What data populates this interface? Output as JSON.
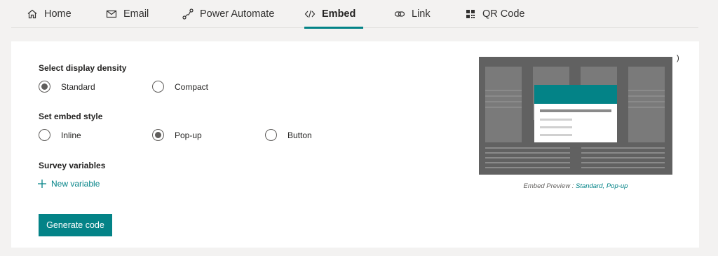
{
  "tabs": [
    {
      "label": "Home",
      "icon": "home-icon",
      "active": false
    },
    {
      "label": "Email",
      "icon": "email-icon",
      "active": false
    },
    {
      "label": "Power Automate",
      "icon": "flow-icon",
      "active": false
    },
    {
      "label": "Embed",
      "icon": "embed-icon",
      "active": true
    },
    {
      "label": "Link",
      "icon": "link-icon",
      "active": false
    },
    {
      "label": "QR Code",
      "icon": "qr-code-icon",
      "active": false
    }
  ],
  "density": {
    "label": "Select display density",
    "options": [
      {
        "label": "Standard",
        "selected": true
      },
      {
        "label": "Compact",
        "selected": false
      }
    ]
  },
  "style": {
    "label": "Set embed style",
    "options": [
      {
        "label": "Inline",
        "selected": false
      },
      {
        "label": "Pop-up",
        "selected": true
      },
      {
        "label": "Button",
        "selected": false
      }
    ]
  },
  "variables": {
    "label": "Survey variables",
    "new_label": "New variable"
  },
  "generate_label": "Generate code",
  "preview": {
    "caption_prefix": "Embed Preview : ",
    "caption_value": "Standard, Pop-up",
    "paren": ")"
  },
  "colors": {
    "accent": "#038387",
    "preview_bg": "#616161",
    "preview_block": "#7a7a7a"
  }
}
